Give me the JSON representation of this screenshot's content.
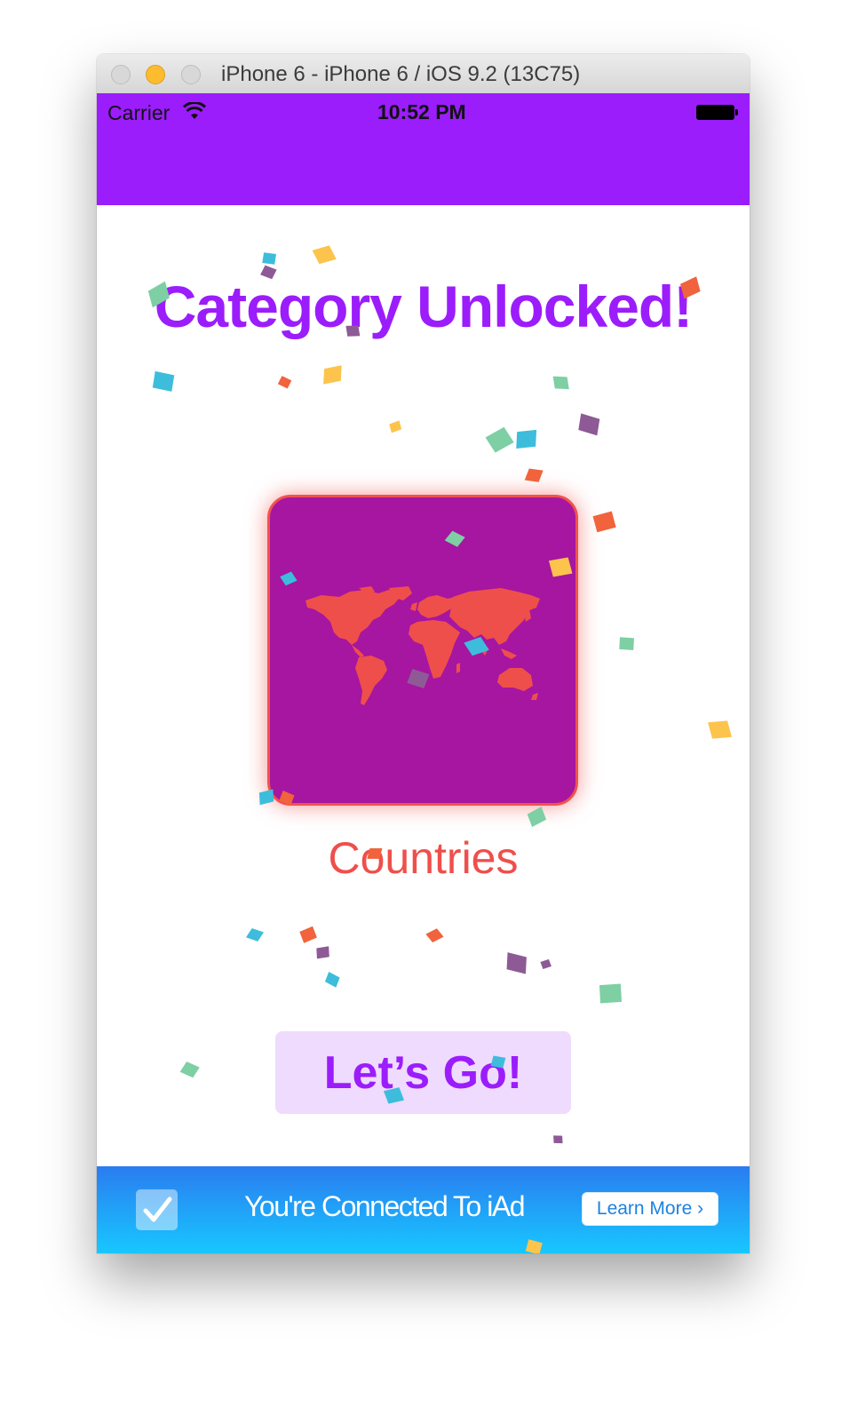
{
  "window": {
    "title": "iPhone 6 - iPhone 6 / iOS 9.2 (13C75)"
  },
  "status_bar": {
    "carrier": "Carrier",
    "time": "10:52 PM",
    "color": "#9b1dfb"
  },
  "main": {
    "headline": "Category Unlocked!",
    "category": {
      "name": "Countries",
      "icon": "world-map-icon",
      "tile_color": "#a616a0",
      "accent_color": "#ef4f4b"
    },
    "action_button_label": "Let’s Go!"
  },
  "ad_banner": {
    "message": "You're Connected To iAd",
    "button_label": "Learn More ›"
  },
  "colors": {
    "brand_purple": "#9b1dfb",
    "button_bg": "#efdbfd",
    "confetti": [
      "#7ecfa3",
      "#3dbddb",
      "#fcc44c",
      "#f0633c",
      "#8e5a96"
    ]
  }
}
